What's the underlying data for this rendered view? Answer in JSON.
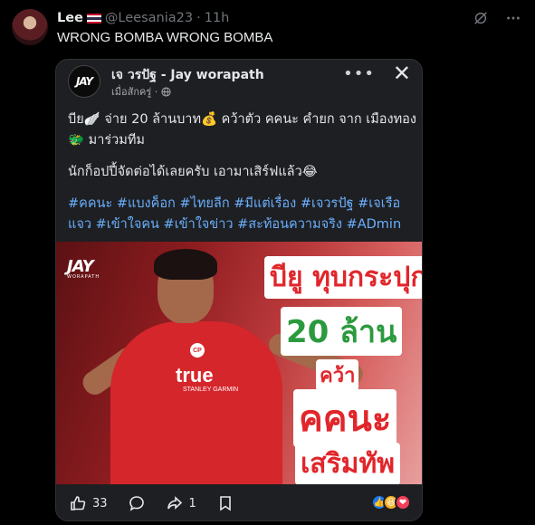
{
  "tweet": {
    "author_name": "Lee",
    "author_handle": "@Leesania23",
    "separator": "·",
    "time": "11h",
    "text": "WRONG BOMBA WRONG BOMBA"
  },
  "card": {
    "page_name": "เจ วรปัฐ - Jay worapath",
    "meta": "เมื่อสักครู่ ·",
    "menu": "•••",
    "close": "✕",
    "avatar_text": "JAY",
    "post_line1": "บีย🪽 จ่าย 20 ล้านบาท💰 คว้าตัว คคนะ คำยก จาก เมืองทอง 🐲 มาร่วมทีม",
    "post_line2": "นักก็อปปี้จัดต่อได้เลยครับ เอามาเสิร์ฟแล้ว😂",
    "hashtags": "#คคนะ #แบงค็อก #ไทยลีก #มีแต่เรื่อง #เจวรปัฐ #เจเรือแจว #เข้าใจคน #เข้าใจข่าว #สะท้อนความจริง #ADmin"
  },
  "photo": {
    "logo": "JAY",
    "logo_sub": "WORAPATH",
    "jersey": "true",
    "jersey_sub": "STANLEY GARMIN",
    "cp": "CP",
    "headline1": "บียู ทุบกระปุก",
    "headline2": "20 ล้าน",
    "headline3": "คว้า",
    "headline4": "คคนะ",
    "headline5": "เสริมทัพ"
  },
  "actions": {
    "likes": "33",
    "shares": "1"
  },
  "colors": {
    "background": "#000000",
    "card": "#1e1f22",
    "hashtag": "#6ab0ff",
    "headline_red": "#e1262b",
    "headline_green": "#2b9a3e"
  }
}
